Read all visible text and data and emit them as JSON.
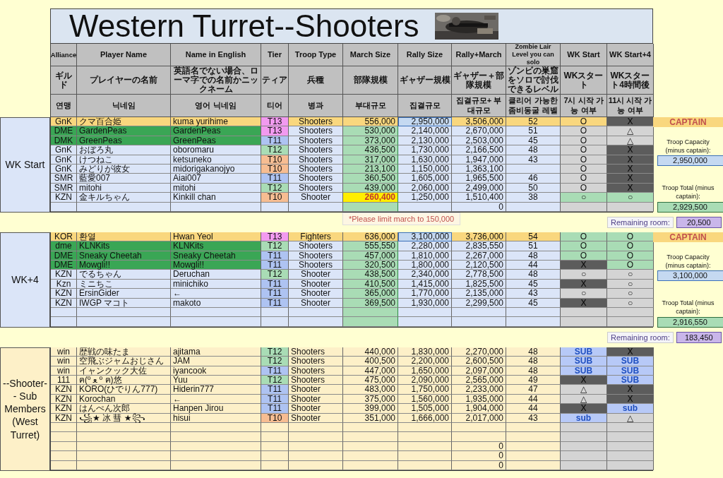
{
  "title": "Western Turret--Shooters",
  "header_rows": [
    [
      "Alliance",
      "Player Name",
      "Name in English",
      "Tier",
      "Troop Type",
      "March Size",
      "Rally Size",
      "Rally+March",
      "Zombie Lair Level you can solo",
      "WK Start",
      "WK Start+4"
    ],
    [
      "ギルド",
      "プレイヤーの名前",
      "英語名でない場合、ローマ字での名前かニックネーム",
      "ティア",
      "兵種",
      "部隊規模",
      "ギャザー規模",
      "ギャザー＋部隊規模",
      "ゾンビの巣窟をソロで討伐できるレベル",
      "WKスタート",
      "WKスタート4時間後"
    ],
    [
      "연맹",
      "닉네임",
      "영어 닉네임",
      "티어",
      "병과",
      "부대규모",
      "집결규모",
      "집결규모+ 부대규모",
      "클리어 가능한 좀비동굴 레벨",
      "7시 시작 가능 여부",
      "11시 시작 가능 여부"
    ]
  ],
  "sections": [
    {
      "label": "WK Start",
      "kind": "main",
      "rows": [
        {
          "kind": "captain",
          "warning": false,
          "alliance": "GnK",
          "player": "クマ百合姫",
          "english": "kuma yurihime",
          "tier": {
            "text": "T13",
            "color": "#f29af0"
          },
          "troop": "Shooters",
          "march": "556,000",
          "rally": "2,950,000",
          "total": "3,506,000",
          "zombie": "52",
          "wk_start": {
            "text": "O",
            "kind": "row"
          },
          "wk_plus4": {
            "text": "X",
            "kind": "dark"
          }
        },
        {
          "kind": "highlight",
          "warning": false,
          "alliance": "DME",
          "player": "GardenPeas",
          "english": "GardenPeas",
          "tier": {
            "text": "T13",
            "color": "#f29af0"
          },
          "troop": "Shooters",
          "march": "530,000",
          "rally": "2,140,000",
          "total": "2,670,000",
          "zombie": "51",
          "wk_start": {
            "text": "O",
            "kind": "light"
          },
          "wk_plus4": {
            "text": "△",
            "kind": "light"
          }
        },
        {
          "kind": "highlight",
          "warning": false,
          "alliance": "DMK",
          "player": "GreenPeas",
          "english": "GreenPeas",
          "tier": {
            "text": "T11",
            "color": "#aec3f2"
          },
          "troop": "Shooters",
          "march": "373,000",
          "rally": "2,130,000",
          "total": "2,503,000",
          "zombie": "45",
          "wk_start": {
            "text": "O",
            "kind": "light"
          },
          "wk_plus4": {
            "text": "△",
            "kind": "light"
          }
        },
        {
          "kind": "plain",
          "warning": false,
          "alliance": "GnK",
          "player": "おぼろ丸",
          "english": "oboromaru",
          "tier": {
            "text": "T12",
            "color": "#a9dcb5"
          },
          "troop": "Shooters",
          "march": "436,500",
          "rally": "1,730,000",
          "total": "2,166,500",
          "zombie": "48",
          "wk_start": {
            "text": "O",
            "kind": "light"
          },
          "wk_plus4": {
            "text": "X",
            "kind": "dark"
          }
        },
        {
          "kind": "plain",
          "warning": false,
          "alliance": "GnK",
          "player": "けつねこ",
          "english": "ketsuneko",
          "tier": {
            "text": "T10",
            "color": "#f7bd92"
          },
          "troop": "Shooters",
          "march": "317,000",
          "rally": "1,630,000",
          "total": "1,947,000",
          "zombie": "43",
          "wk_start": {
            "text": "O",
            "kind": "light"
          },
          "wk_plus4": {
            "text": "X",
            "kind": "dark"
          }
        },
        {
          "kind": "plain",
          "warning": false,
          "alliance": "GnK",
          "player": "みどりが彼女",
          "english": "midorigakanojyo",
          "tier": {
            "text": "T10",
            "color": "#f7bd92"
          },
          "troop": "Shooters",
          "march": "213,100",
          "rally": "1,150,000",
          "total": "1,363,100",
          "wk_start": {
            "text": "O",
            "kind": "light"
          },
          "wk_plus4": {
            "text": "X",
            "kind": "dark"
          }
        },
        {
          "kind": "plain",
          "warning": false,
          "alliance": "SMR",
          "player": "藍愛007",
          "english": "Aiai007",
          "tier": {
            "text": "T11",
            "color": "#aec3f2"
          },
          "troop": "Shooters",
          "march": "360,500",
          "rally": "1,605,000",
          "total": "1,965,500",
          "zombie": "46",
          "wk_start": {
            "text": "O",
            "kind": "light"
          },
          "wk_plus4": {
            "text": "X",
            "kind": "dark"
          }
        },
        {
          "kind": "plain",
          "warning": false,
          "alliance": "SMR",
          "player": "mitohi",
          "english": "mitohi",
          "tier": {
            "text": "T12",
            "color": "#a9dcb5"
          },
          "troop": "Shooters",
          "march": "439,000",
          "rally": "2,060,000",
          "total": "2,499,000",
          "zombie": "50",
          "wk_start": {
            "text": "O",
            "kind": "light"
          },
          "wk_plus4": {
            "text": "X",
            "kind": "dark"
          }
        },
        {
          "kind": "plain",
          "warning": true,
          "alliance": "KZN",
          "player": "金キルちゃん",
          "english": "Kinkill chan",
          "tier": {
            "text": "T10",
            "color": "#f7bd92"
          },
          "troop": "Shooter",
          "march": "260,400",
          "rally": "1,250,000",
          "total": "1,510,400",
          "zombie": "38",
          "wk_start": {
            "text": "○",
            "kind": "green"
          },
          "wk_plus4": {
            "text": "○",
            "kind": "green"
          }
        },
        {
          "kind": "empty",
          "total": "0"
        }
      ],
      "side": {
        "captain": "CAPTAIN",
        "capacity_label": "Troop Capacity (minus captain):",
        "capacity": "2,950,000",
        "total_label": "Troop Total (minus captain):",
        "total": "2,929,500"
      },
      "note": "*Please limit march to 150,000",
      "remaining": {
        "label": "Remaining room:",
        "value": "20,500"
      }
    },
    {
      "label": "WK+4",
      "kind": "main",
      "rows": [
        {
          "kind": "captain",
          "warning": false,
          "alliance": "KOR",
          "player": "환열",
          "english": "Hwan Yeol",
          "tier": {
            "text": "T13",
            "color": "#f29af0"
          },
          "troop": "Fighters",
          "march": "636,000",
          "rally": "3,100,000",
          "total": "3,736,000",
          "zombie": "54",
          "wk_start": {
            "text": "O",
            "kind": "green"
          },
          "wk_plus4": {
            "text": "O",
            "kind": "green"
          }
        },
        {
          "kind": "highlight",
          "warning": false,
          "alliance": "dme",
          "player": "KLNKits",
          "english": "KLNKits",
          "tier": {
            "text": "T12",
            "color": "#a9dcb5"
          },
          "troop": "Shooters",
          "march": "555,550",
          "rally": "2,280,000",
          "total": "2,835,550",
          "zombie": "51",
          "wk_start": {
            "text": "O",
            "kind": "green"
          },
          "wk_plus4": {
            "text": "O",
            "kind": "green"
          }
        },
        {
          "kind": "highlight",
          "warning": false,
          "alliance": "DME",
          "player": "Sneaky Cheetah",
          "english": "Sneaky Cheetah",
          "tier": {
            "text": "T11",
            "color": "#aec3f2"
          },
          "troop": "Shooters",
          "march": "457,000",
          "rally": "1,810,000",
          "total": "2,267,000",
          "zombie": "48",
          "wk_start": {
            "text": "O",
            "kind": "green"
          },
          "wk_plus4": {
            "text": "O",
            "kind": "green"
          }
        },
        {
          "kind": "highlight",
          "warning": false,
          "alliance": "DME",
          "player": "Mowgli!!",
          "english": "Mowgli!!",
          "tier": {
            "text": "T11",
            "color": "#aec3f2"
          },
          "troop": "Shooters",
          "march": "320,500",
          "rally": "1,800,000",
          "total": "2,120,500",
          "zombie": "44",
          "wk_start": {
            "text": "X",
            "kind": "dark"
          },
          "wk_plus4": {
            "text": "O",
            "kind": "green"
          }
        },
        {
          "kind": "plain",
          "warning": false,
          "alliance": "KZN",
          "player": "でるちゃん",
          "english": "Deruchan",
          "tier": {
            "text": "T12",
            "color": "#a9dcb5"
          },
          "troop": "Shooter",
          "march": "438,500",
          "rally": "2,340,000",
          "total": "2,778,500",
          "zombie": "48",
          "wk_start": {
            "text": "○",
            "kind": "light"
          },
          "wk_plus4": {
            "text": "○",
            "kind": "light"
          }
        },
        {
          "kind": "plain",
          "warning": false,
          "alliance": "Kzn",
          "player": "ミニちこ",
          "english": "minichiko",
          "tier": {
            "text": "T11",
            "color": "#aec3f2"
          },
          "troop": "Shooter",
          "march": "410,500",
          "rally": "1,415,000",
          "total": "1,825,500",
          "zombie": "45",
          "wk_start": {
            "text": "X",
            "kind": "dark"
          },
          "wk_plus4": {
            "text": "○",
            "kind": "light"
          }
        },
        {
          "kind": "plain",
          "warning": false,
          "alliance": "KZN",
          "player": "ErsinGider",
          "english": "←",
          "tier": {
            "text": "T11",
            "color": "#aec3f2"
          },
          "troop": "Shooter",
          "march": "365,000",
          "rally": "1,770,000",
          "total": "2,135,000",
          "zombie": "43",
          "wk_start": {
            "text": "○",
            "kind": "light"
          },
          "wk_plus4": {
            "text": "○",
            "kind": "light"
          }
        },
        {
          "kind": "plain",
          "warning": false,
          "alliance": "KZN",
          "player": "IWGP マコト",
          "english": "makoto",
          "tier": {
            "text": "T11",
            "color": "#aec3f2"
          },
          "troop": "Shooter",
          "march": "369,500",
          "rally": "1,930,000",
          "total": "2,299,500",
          "zombie": "45",
          "wk_start": {
            "text": "X",
            "kind": "dark"
          },
          "wk_plus4": {
            "text": "○",
            "kind": "light"
          }
        },
        {
          "kind": "empty"
        },
        {
          "kind": "empty"
        }
      ],
      "side": {
        "captain": "CAPTAIN",
        "capacity_label": "Troop Capacity (minus captain):",
        "capacity": "3,100,000",
        "total_label": "Troop Total (minus captain):",
        "total": "2,916,550"
      },
      "remaining": {
        "label": "Remaining room:",
        "value": "183,450"
      }
    },
    {
      "label": "--Shooter-- Sub Members (West Turret)",
      "kind": "sub",
      "rows": [
        {
          "kind": "plain",
          "warning": false,
          "alliance": "win",
          "player": "歴戦の味たま",
          "english": "ajitama",
          "tier": {
            "text": "T12",
            "color": "#a9dcb5"
          },
          "troop": "Shooters",
          "march": "440,000",
          "rally": "1,830,000",
          "total": "2,270,000",
          "zombie": "48",
          "wk_start": {
            "text": "SUB",
            "kind": "blue"
          },
          "wk_plus4": {
            "text": "X",
            "kind": "dark"
          }
        },
        {
          "kind": "plain",
          "warning": false,
          "alliance": "win",
          "player": "空飛ぶジャムおじさん",
          "english": "JAM",
          "tier": {
            "text": "T12",
            "color": "#a9dcb5"
          },
          "troop": "Shooters",
          "march": "400,500",
          "rally": "2,200,000",
          "total": "2,600,500",
          "zombie": "48",
          "wk_start": {
            "text": "SUB",
            "kind": "blue"
          },
          "wk_plus4": {
            "text": "SUB",
            "kind": "blue"
          }
        },
        {
          "kind": "plain",
          "warning": false,
          "alliance": "win",
          "player": "イャンクック大佐",
          "english": "iyancook",
          "tier": {
            "text": "T11",
            "color": "#aec3f2"
          },
          "troop": "Shooters",
          "march": "447,000",
          "rally": "1,650,000",
          "total": "2,097,000",
          "zombie": "48",
          "wk_start": {
            "text": "SUB",
            "kind": "blue"
          },
          "wk_plus4": {
            "text": "SUB",
            "kind": "blue"
          }
        },
        {
          "kind": "plain",
          "warning": false,
          "alliance": "111",
          "player": "ฅ(º ﻌ º ฅ)悠",
          "english": "Yuu",
          "tier": {
            "text": "T12",
            "color": "#a9dcb5"
          },
          "troop": "Shooters",
          "march": "475,000",
          "rally": "2,090,000",
          "total": "2,565,000",
          "zombie": "49",
          "wk_start": {
            "text": "X",
            "kind": "dark"
          },
          "wk_plus4": {
            "text": "SUB",
            "kind": "blue"
          }
        },
        {
          "kind": "plain",
          "warning": false,
          "alliance": "KZN",
          "player": "KORO(ひでりん777)",
          "english": "Hiderin777",
          "tier": {
            "text": "T11",
            "color": "#aec3f2"
          },
          "troop": "Shooter",
          "march": "483,000",
          "rally": "1,750,000",
          "total": "2,233,000",
          "zombie": "47",
          "wk_start": {
            "text": "△",
            "kind": "light"
          },
          "wk_plus4": {
            "text": "X",
            "kind": "dark"
          }
        },
        {
          "kind": "plain",
          "warning": false,
          "alliance": "KZN",
          "player": "Korochan",
          "english": "←",
          "tier": {
            "text": "T11",
            "color": "#aec3f2"
          },
          "troop": "Shooter",
          "march": "375,000",
          "rally": "1,560,000",
          "total": "1,935,000",
          "zombie": "44",
          "wk_start": {
            "text": "△",
            "kind": "light"
          },
          "wk_plus4": {
            "text": "X",
            "kind": "dark"
          }
        },
        {
          "kind": "plain",
          "warning": false,
          "alliance": "KZN",
          "player": "はんぺん次郎",
          "english": "Hanpen Jirou",
          "tier": {
            "text": "T11",
            "color": "#aec3f2"
          },
          "troop": "Shooter",
          "march": "399,000",
          "rally": "1,505,000",
          "total": "1,904,000",
          "zombie": "44",
          "wk_start": {
            "text": "X",
            "kind": "dark"
          },
          "wk_plus4": {
            "text": "sub",
            "kind": "blue"
          }
        },
        {
          "kind": "plain",
          "warning": false,
          "alliance": "KZN",
          "player": "꧁★ 冰 彗 ★꧂",
          "english": "hisui",
          "tier": {
            "text": "T10",
            "color": "#f7bd92"
          },
          "troop": "Shooter",
          "march": "351,000",
          "rally": "1,666,000",
          "total": "2,017,000",
          "zombie": "43",
          "wk_start": {
            "text": "sub",
            "kind": "blue"
          },
          "wk_plus4": {
            "text": "△",
            "kind": "light"
          }
        },
        {
          "kind": "empty"
        },
        {
          "kind": "empty"
        },
        {
          "kind": "empty",
          "total": "0"
        },
        {
          "kind": "empty",
          "total": "0"
        },
        {
          "kind": "empty",
          "total": "0"
        }
      ]
    }
  ]
}
